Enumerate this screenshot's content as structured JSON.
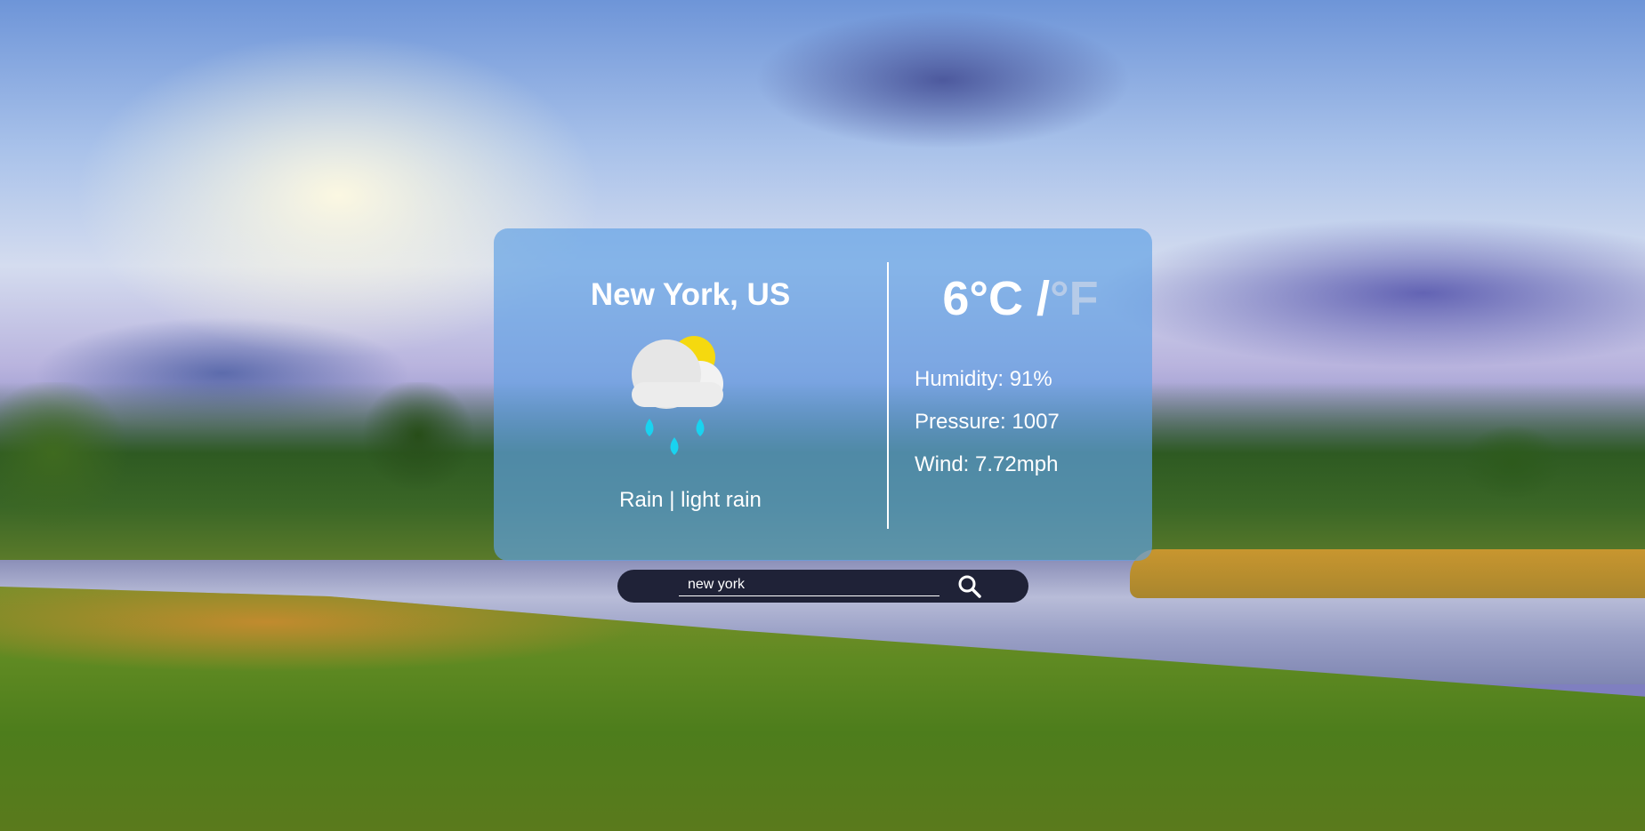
{
  "weather": {
    "city": "New York, US",
    "condition": "Rain | light rain",
    "icon": "rain-with-sun-icon",
    "temp_c": "6°C",
    "separator": " /",
    "unit_f": "°F",
    "humidity": "Humidity: 91%",
    "pressure": "Pressure: 1007",
    "wind": "Wind: 7.72mph"
  },
  "search": {
    "value": "new york",
    "icon": "search-icon"
  },
  "colors": {
    "card_bg": "#60a0e4",
    "search_bg": "#1f2237",
    "sun": "#f5d90f",
    "rain_drop": "#19d3f0",
    "inactive_unit": "#b6cbe8"
  }
}
